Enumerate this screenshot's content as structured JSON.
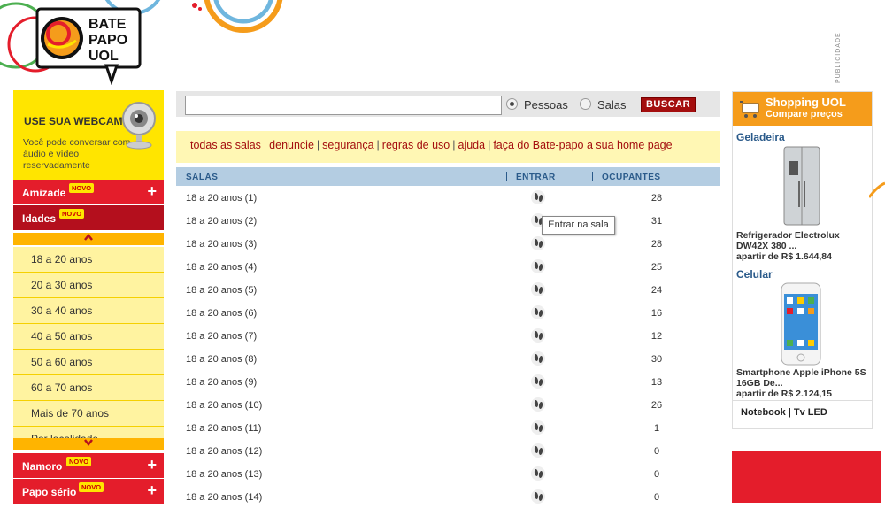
{
  "logo": {
    "line1": "BATE",
    "line2": "PAPO",
    "line3": "UOL"
  },
  "publicidade": "PUBLICIDADE",
  "sidebar": {
    "webcam_title": "USE SUA WEBCAM!",
    "webcam_desc": "Você pode conversar com áudio e vídeo reservadamente",
    "menu": [
      {
        "label": "Amizade",
        "badge": "NOVO",
        "plus": "+"
      },
      {
        "label": "Idades",
        "badge": "NOVO"
      }
    ],
    "ages": [
      "18 a 20 anos",
      "20 a 30 anos",
      "30 a 40 anos",
      "40 a 50 anos",
      "50 a 60 anos",
      "60 a 70 anos",
      "Mais de 70 anos",
      "Por localidade"
    ],
    "arrow_up": "⌃",
    "arrow_down": "⌄",
    "bottom_menu": [
      {
        "label": "Namoro",
        "badge": "NOVO",
        "plus": "+"
      },
      {
        "label": "Papo sério",
        "badge": "NOVO",
        "plus": "+"
      }
    ]
  },
  "search": {
    "value": "",
    "option_people": "Pessoas",
    "option_rooms": "Salas",
    "selected": "Pessoas",
    "button": "BUSCAR"
  },
  "links": [
    "todas as salas",
    "denuncie",
    "segurança",
    "regras de uso",
    "ajuda",
    "faça do Bate-papo a sua home page"
  ],
  "table": {
    "headers": {
      "rooms": "SALAS",
      "enter": "ENTRAR",
      "occupants": "OCUPANTES"
    },
    "rows": [
      {
        "name": "18 a 20 anos (1)",
        "occupants": "28"
      },
      {
        "name": "18 a 20 anos (2)",
        "occupants": "31"
      },
      {
        "name": "18 a 20 anos (3)",
        "occupants": "28"
      },
      {
        "name": "18 a 20 anos (4)",
        "occupants": "25"
      },
      {
        "name": "18 a 20 anos (5)",
        "occupants": "24"
      },
      {
        "name": "18 a 20 anos (6)",
        "occupants": "16"
      },
      {
        "name": "18 a 20 anos (7)",
        "occupants": "12"
      },
      {
        "name": "18 a 20 anos (8)",
        "occupants": "30"
      },
      {
        "name": "18 a 20 anos (9)",
        "occupants": "13"
      },
      {
        "name": "18 a 20 anos (10)",
        "occupants": "26"
      },
      {
        "name": "18 a 20 anos (11)",
        "occupants": "1"
      },
      {
        "name": "18 a 20 anos (12)",
        "occupants": "0"
      },
      {
        "name": "18 a 20 anos (13)",
        "occupants": "0"
      },
      {
        "name": "18 a 20 anos (14)",
        "occupants": "0"
      }
    ],
    "tooltip": "Entrar na sala"
  },
  "shopping": {
    "title": "Shopping UOL",
    "subtitle": "Compare preços",
    "products": [
      {
        "category": "Geladeira",
        "name": "Refrigerador Electrolux DW42X 380 ...",
        "price": "apartir de R$ 1.644,84"
      },
      {
        "category": "Celular",
        "name": "Smartphone Apple iPhone 5S 16GB De...",
        "price": "apartir de R$ 2.124,15"
      }
    ],
    "links": "Notebook | Tv LED"
  },
  "colors": {
    "red": "#e41d2b",
    "yellow": "#ffe500",
    "orange": "#f59c1b",
    "dark_red": "#a40e0e",
    "header_blue": "#b4cde2"
  }
}
